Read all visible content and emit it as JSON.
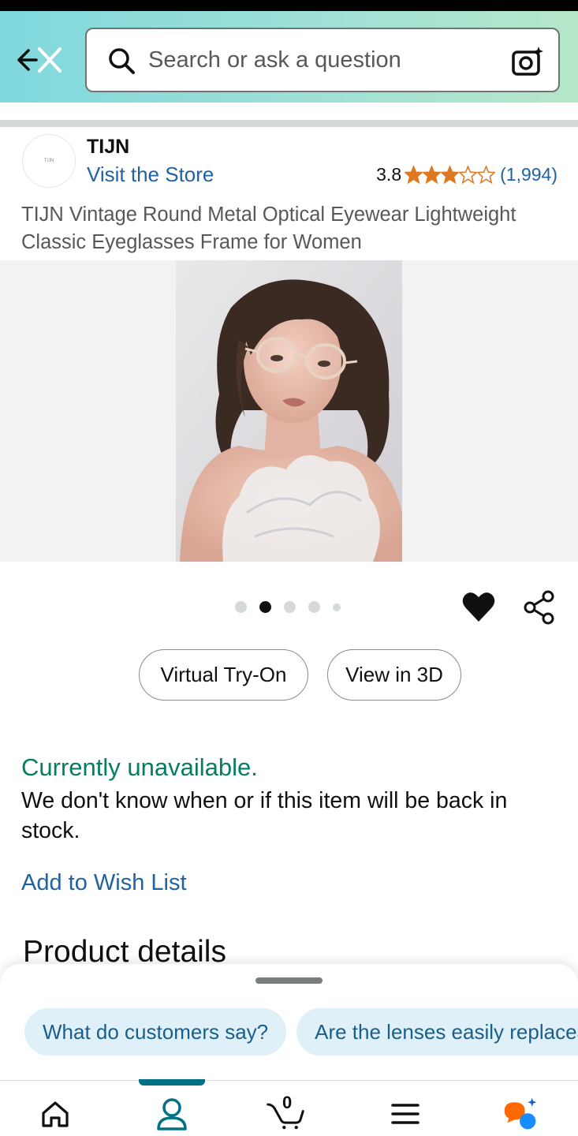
{
  "header": {
    "search_placeholder": "Search or ask a question",
    "back_icon": "back-close-icon",
    "camera_icon": "camera-lens-icon"
  },
  "brand": {
    "name": "TIJN",
    "logo_text": "TIJN",
    "visit_store": "Visit the Store"
  },
  "rating": {
    "value": "3.8",
    "stars": 3.8,
    "count": "(1,994)",
    "star_color": "#de7921"
  },
  "product": {
    "title": "TIJN Vintage Round Metal Optical Eyewear Lightweight Classic Eyeglasses Frame for Women",
    "image_icon": "product-photo",
    "carousel_count": 5,
    "carousel_active": 1
  },
  "actions": {
    "virtual_try_on": "Virtual Try-On",
    "view_in_3d": "View in 3D"
  },
  "availability": {
    "status": "Currently unavailable.",
    "message": "We don't know when or if this item will be back in stock.",
    "status_color": "#067d62"
  },
  "wish_list": "Add to Wish List",
  "product_details_heading": "Product details",
  "suggestions": [
    "What do customers say?",
    "Are the lenses easily replaceable?"
  ],
  "nav": {
    "cart_count": "0",
    "accent": "#007185"
  }
}
